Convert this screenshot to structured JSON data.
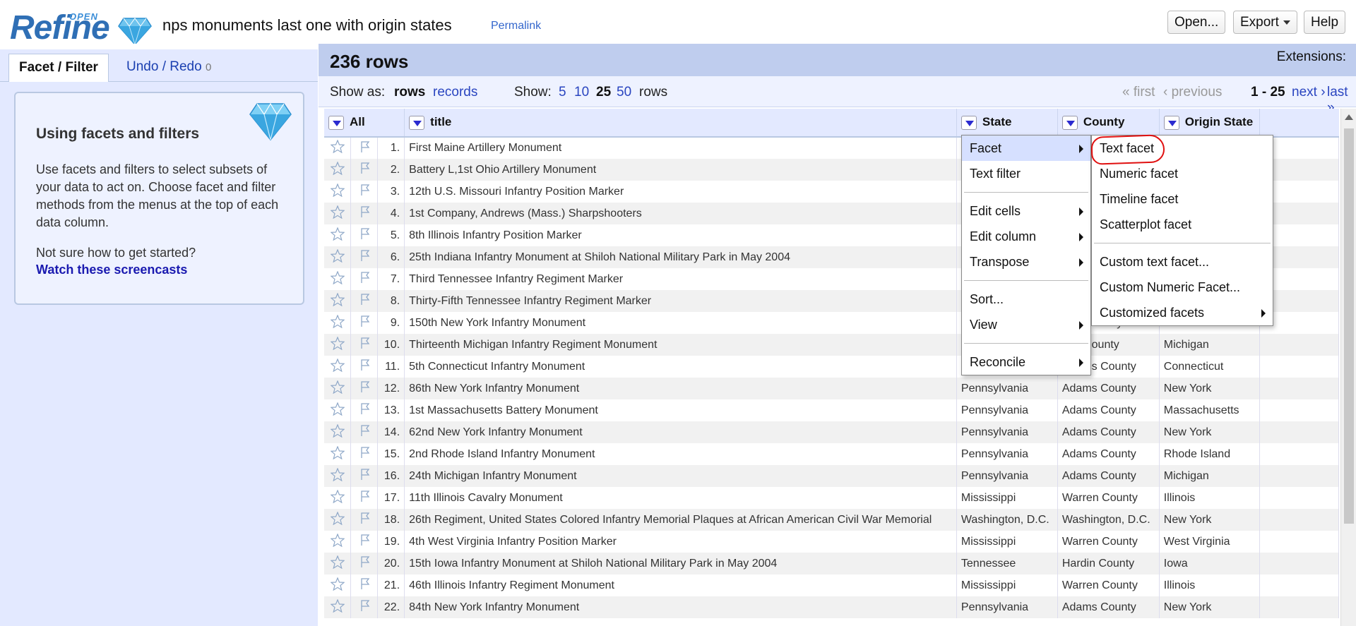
{
  "app": {
    "logo_open": "OPEN",
    "logo_refine": "Refine",
    "project_title": "nps monuments last one with origin states",
    "permalink": "Permalink",
    "buttons": {
      "open": "Open...",
      "export": "Export",
      "help": "Help"
    }
  },
  "left_panel": {
    "tabs": {
      "facet_filter": "Facet / Filter",
      "undo_redo": "Undo / Redo",
      "undo_count": "0"
    },
    "help": {
      "title": "Using facets and filters",
      "text": "Use facets and filters to select subsets of your data to act on. Choose facet and filter methods from the menus at the top of each data column.",
      "question": "Not sure how to get started?",
      "link": "Watch these screencasts"
    }
  },
  "main": {
    "row_count": "236 rows",
    "extensions": "Extensions:",
    "view": {
      "show_as": "Show as:",
      "rows": "rows",
      "records": "records",
      "show": "Show:",
      "sizes": [
        "5",
        "10",
        "25",
        "50"
      ],
      "rows_suffix": "rows",
      "first": "« first",
      "previous": "‹ previous",
      "range": "1 - 25",
      "next": "next ›",
      "last": "last »"
    },
    "columns": {
      "all": "All",
      "title": "title",
      "state": "State",
      "county": "County",
      "origin": "Origin State"
    },
    "rows": [
      {
        "n": "1.",
        "title": "First Maine Artillery Monument",
        "state": "",
        "county": "",
        "origin": ""
      },
      {
        "n": "2.",
        "title": "Battery L,1st Ohio Artillery Monument",
        "state": "",
        "county": "",
        "origin": ""
      },
      {
        "n": "3.",
        "title": "12th U.S. Missouri Infantry Position Marker",
        "state": "",
        "county": "",
        "origin": ""
      },
      {
        "n": "4.",
        "title": "1st Company, Andrews (Mass.) Sharpshooters",
        "state": "",
        "county": "",
        "origin": ""
      },
      {
        "n": "5.",
        "title": "8th Illinois Infantry Position Marker",
        "state": "",
        "county": "",
        "origin": ""
      },
      {
        "n": "6.",
        "title": "25th Indiana Infantry Monument at Shiloh National Military Park in May 2004",
        "state": "",
        "county": "",
        "origin": ""
      },
      {
        "n": "7.",
        "title": "Third Tennessee Infantry Regiment Marker",
        "state": "",
        "county": "",
        "origin": ""
      },
      {
        "n": "8.",
        "title": "Thirty-Fifth Tennessee Infantry Regiment Marker",
        "state": "",
        "county": "",
        "origin": ""
      },
      {
        "n": "9.",
        "title": "150th New York Infantry Monument",
        "state": "",
        "county": "ams County",
        "origin": "New York"
      },
      {
        "n": "10.",
        "title": "Thirteenth Michigan Infantry Regiment Monument",
        "state": "",
        "county": "osa County",
        "origin": "Michigan"
      },
      {
        "n": "11.",
        "title": "5th Connecticut Infantry Monument",
        "state": "Pennsylvania",
        "county": "Adams County",
        "origin": "Connecticut"
      },
      {
        "n": "12.",
        "title": "86th New York Infantry Monument",
        "state": "Pennsylvania",
        "county": "Adams County",
        "origin": "New York"
      },
      {
        "n": "13.",
        "title": "1st Massachusetts Battery Monument",
        "state": "Pennsylvania",
        "county": "Adams County",
        "origin": "Massachusetts"
      },
      {
        "n": "14.",
        "title": "62nd New York Infantry Monument",
        "state": "Pennsylvania",
        "county": "Adams County",
        "origin": "New York"
      },
      {
        "n": "15.",
        "title": "2nd Rhode Island Infantry Monument",
        "state": "Pennsylvania",
        "county": "Adams County",
        "origin": "Rhode Island"
      },
      {
        "n": "16.",
        "title": "24th Michigan Infantry Monument",
        "state": "Pennsylvania",
        "county": "Adams County",
        "origin": "Michigan"
      },
      {
        "n": "17.",
        "title": "11th Illinois Cavalry Monument",
        "state": "Mississippi",
        "county": "Warren County",
        "origin": "Illinois"
      },
      {
        "n": "18.",
        "title": "26th Regiment, United States Colored Infantry Memorial Plaques at African American Civil War Memorial",
        "state": "Washington, D.C.",
        "county": "Washington, D.C.",
        "origin": "New York"
      },
      {
        "n": "19.",
        "title": "4th West Virginia Infantry Position Marker",
        "state": "Mississippi",
        "county": "Warren County",
        "origin": "West Virginia"
      },
      {
        "n": "20.",
        "title": "15th Iowa Infantry Monument at Shiloh National Military Park in May 2004",
        "state": "Tennessee",
        "county": "Hardin County",
        "origin": "Iowa"
      },
      {
        "n": "21.",
        "title": "46th Illinois Infantry Regiment Monument",
        "state": "Mississippi",
        "county": "Warren County",
        "origin": "Illinois"
      },
      {
        "n": "22.",
        "title": "84th New York Infantry Monument",
        "state": "Pennsylvania",
        "county": "Adams County",
        "origin": "New York"
      }
    ]
  },
  "column_menu": {
    "items": [
      {
        "label": "Facet",
        "submenu": true,
        "highlight": true
      },
      {
        "label": "Text filter",
        "submenu": false
      },
      {
        "sep": true
      },
      {
        "label": "Edit cells",
        "submenu": true
      },
      {
        "label": "Edit column",
        "submenu": true
      },
      {
        "label": "Transpose",
        "submenu": true
      },
      {
        "sep": true
      },
      {
        "label": "Sort...",
        "submenu": false
      },
      {
        "label": "View",
        "submenu": true
      },
      {
        "sep": true
      },
      {
        "label": "Reconcile",
        "submenu": true
      }
    ]
  },
  "facet_submenu": {
    "items": [
      {
        "label": "Text facet",
        "submenu": false
      },
      {
        "label": "Numeric facet",
        "submenu": false
      },
      {
        "label": "Timeline facet",
        "submenu": false
      },
      {
        "label": "Scatterplot facet",
        "submenu": false
      },
      {
        "sep": true
      },
      {
        "label": "Custom text facet...",
        "submenu": false
      },
      {
        "label": "Custom Numeric Facet...",
        "submenu": false
      },
      {
        "label": "Customized facets",
        "submenu": true
      }
    ]
  },
  "colors": {
    "header_blue": "#bfcdee",
    "panel_blue": "#e3e9ff",
    "link": "#2a45c0",
    "annotation_red": "#e01010"
  }
}
